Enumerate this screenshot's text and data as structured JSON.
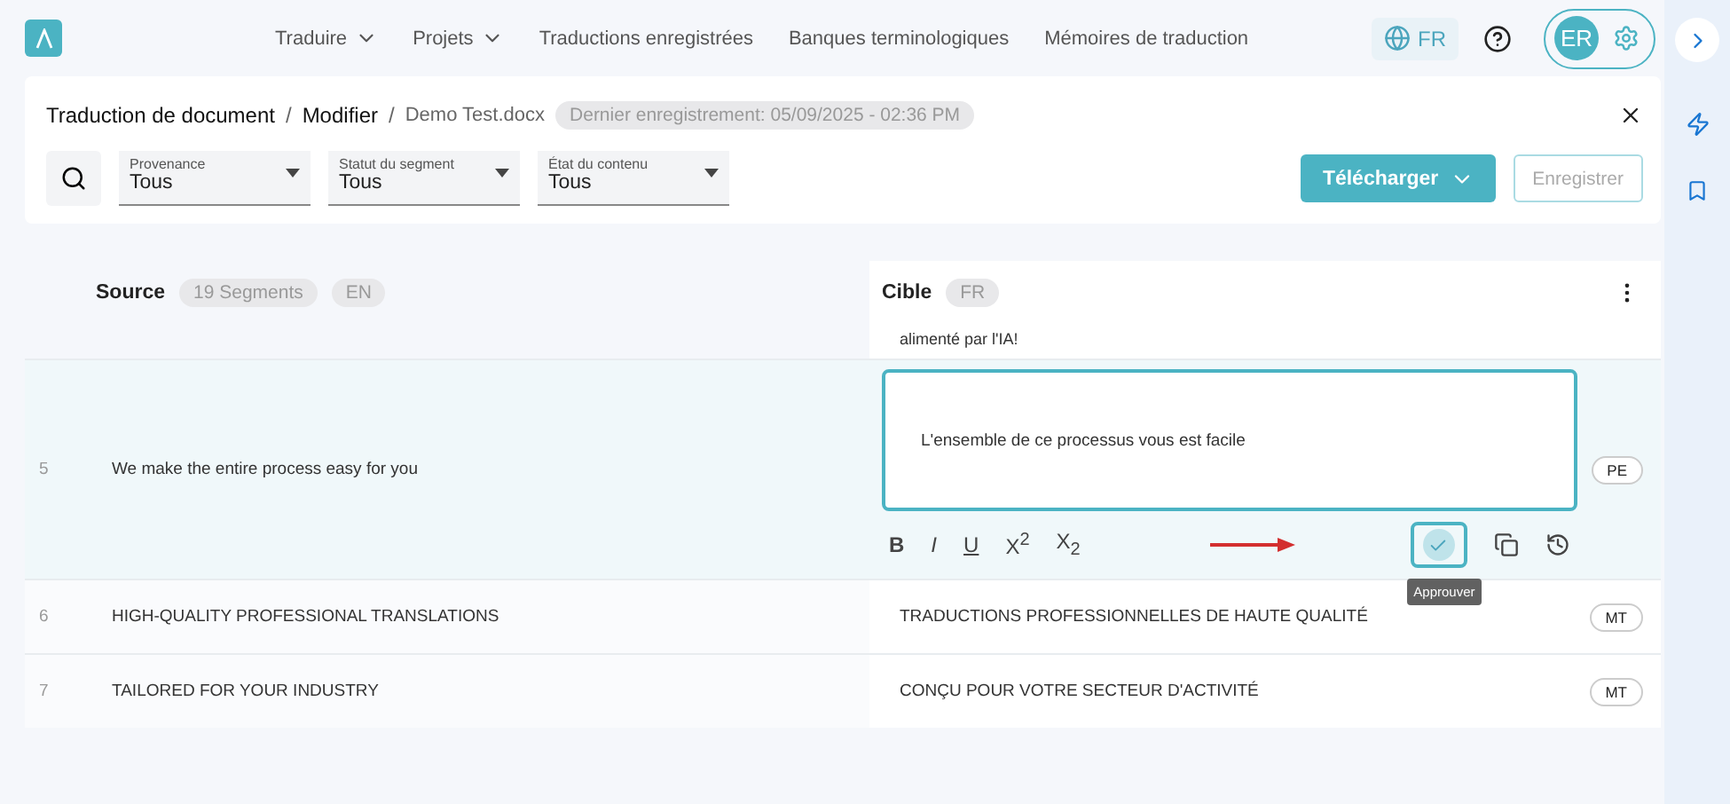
{
  "nav": {
    "menu": [
      {
        "label": "Traduire",
        "dropdown": true
      },
      {
        "label": "Projets",
        "dropdown": true
      },
      {
        "label": "Traductions enregistrées",
        "dropdown": false
      },
      {
        "label": "Banques terminologiques",
        "dropdown": false
      },
      {
        "label": "Mémoires de traduction",
        "dropdown": false
      }
    ],
    "language": "FR",
    "avatar": "ER"
  },
  "header": {
    "separator": "/",
    "breadcrumb": [
      "Traduction de document",
      "Modifier",
      "Demo Test.docx"
    ],
    "last_saved": "Dernier enregistrement: 05/09/2025 - 02:36 PM",
    "filters": [
      {
        "label": "Provenance",
        "value": "Tous"
      },
      {
        "label": "Statut du segment",
        "value": "Tous"
      },
      {
        "label": "État du contenu",
        "value": "Tous"
      }
    ],
    "download": "Télécharger",
    "save": {
      "label": "Enregistrer",
      "disabled": true
    }
  },
  "table": {
    "source_title": "Source",
    "segment_count": "19 Segments",
    "source_lang": "EN",
    "target_title": "Cible",
    "target_lang": "FR",
    "partial_text": "alimenté par l'IA!",
    "rows": [
      {
        "number": "5",
        "source": "We make the entire process easy for you",
        "target": "L'ensemble de ce processus vous est facile",
        "status": "PE",
        "editing": true
      },
      {
        "number": "6",
        "source": "HIGH-QUALITY PROFESSIONAL TRANSLATIONS",
        "target": "TRADUCTIONS PROFESSIONNELLES DE HAUTE QUALITÉ",
        "status": "MT",
        "editing": false
      },
      {
        "number": "7",
        "source": "TAILORED FOR YOUR INDUSTRY",
        "target": "CONÇU POUR VOTRE SECTEUR D'ACTIVITÉ",
        "status": "MT",
        "editing": false
      }
    ],
    "format_buttons": [
      "B",
      "I",
      "U",
      "X$^{2}$",
      "X$_{2}$"
    ],
    "tooltip": "Approuver"
  }
}
